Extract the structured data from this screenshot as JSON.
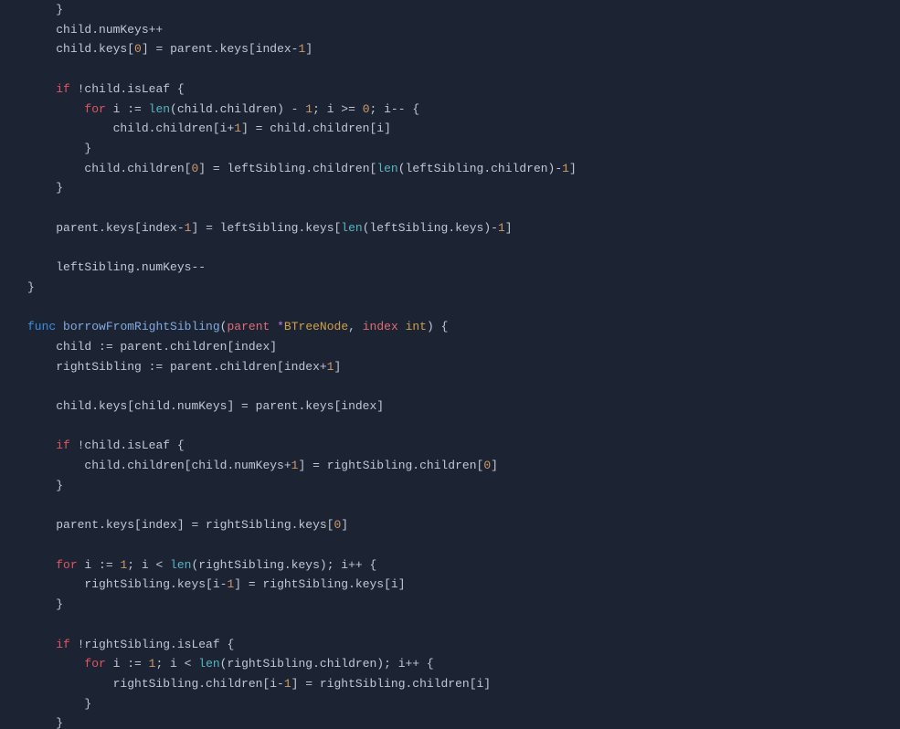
{
  "code": {
    "lines": [
      {
        "indent": 1,
        "tokens": [
          {
            "t": "}",
            "c": "punct"
          }
        ]
      },
      {
        "indent": 1,
        "tokens": [
          {
            "t": "child.numKeys++",
            "c": "punct"
          }
        ]
      },
      {
        "indent": 1,
        "tokens": [
          {
            "t": "child.keys[",
            "c": "punct"
          },
          {
            "t": "0",
            "c": "num"
          },
          {
            "t": "] = parent.keys[index-",
            "c": "punct"
          },
          {
            "t": "1",
            "c": "num"
          },
          {
            "t": "]",
            "c": "punct"
          }
        ]
      },
      {
        "indent": 0,
        "tokens": []
      },
      {
        "indent": 1,
        "tokens": [
          {
            "t": "if",
            "c": "kw-red"
          },
          {
            "t": " !child.isLeaf {",
            "c": "punct"
          }
        ]
      },
      {
        "indent": 2,
        "tokens": [
          {
            "t": "for",
            "c": "kw-red"
          },
          {
            "t": " i := ",
            "c": "punct"
          },
          {
            "t": "len",
            "c": "builtin"
          },
          {
            "t": "(child.children) - ",
            "c": "punct"
          },
          {
            "t": "1",
            "c": "num"
          },
          {
            "t": "; i >= ",
            "c": "punct"
          },
          {
            "t": "0",
            "c": "num"
          },
          {
            "t": "; i-- {",
            "c": "punct"
          }
        ]
      },
      {
        "indent": 3,
        "tokens": [
          {
            "t": "child.children[i+",
            "c": "punct"
          },
          {
            "t": "1",
            "c": "num"
          },
          {
            "t": "] = child.children[i]",
            "c": "punct"
          }
        ]
      },
      {
        "indent": 2,
        "tokens": [
          {
            "t": "}",
            "c": "punct"
          }
        ]
      },
      {
        "indent": 2,
        "tokens": [
          {
            "t": "child.children[",
            "c": "punct"
          },
          {
            "t": "0",
            "c": "num"
          },
          {
            "t": "] = leftSibling.children[",
            "c": "punct"
          },
          {
            "t": "len",
            "c": "builtin"
          },
          {
            "t": "(leftSibling.children)-",
            "c": "punct"
          },
          {
            "t": "1",
            "c": "num"
          },
          {
            "t": "]",
            "c": "punct"
          }
        ]
      },
      {
        "indent": 1,
        "tokens": [
          {
            "t": "}",
            "c": "punct"
          }
        ]
      },
      {
        "indent": 0,
        "tokens": []
      },
      {
        "indent": 1,
        "tokens": [
          {
            "t": "parent.keys[index-",
            "c": "punct"
          },
          {
            "t": "1",
            "c": "num"
          },
          {
            "t": "] = leftSibling.keys[",
            "c": "punct"
          },
          {
            "t": "len",
            "c": "builtin"
          },
          {
            "t": "(leftSibling.keys)-",
            "c": "punct"
          },
          {
            "t": "1",
            "c": "num"
          },
          {
            "t": "]",
            "c": "punct"
          }
        ]
      },
      {
        "indent": 0,
        "tokens": []
      },
      {
        "indent": 1,
        "tokens": [
          {
            "t": "leftSibling.numKeys--",
            "c": "punct"
          }
        ]
      },
      {
        "indent": 0,
        "tokens": [
          {
            "t": "}",
            "c": "punct"
          }
        ]
      },
      {
        "indent": 0,
        "tokens": []
      },
      {
        "indent": 0,
        "tokens": [
          {
            "t": "func",
            "c": "kw-blue"
          },
          {
            "t": " ",
            "c": "punct"
          },
          {
            "t": "borrowFromRightSibling",
            "c": "fn"
          },
          {
            "t": "(",
            "c": "punct"
          },
          {
            "t": "parent",
            "c": "param"
          },
          {
            "t": " ",
            "c": "punct"
          },
          {
            "t": "*",
            "c": "star"
          },
          {
            "t": "BTreeNode",
            "c": "type"
          },
          {
            "t": ", ",
            "c": "punct"
          },
          {
            "t": "index",
            "c": "param"
          },
          {
            "t": " ",
            "c": "punct"
          },
          {
            "t": "int",
            "c": "type"
          },
          {
            "t": ") {",
            "c": "punct"
          }
        ]
      },
      {
        "indent": 1,
        "tokens": [
          {
            "t": "child := parent.children[index]",
            "c": "punct"
          }
        ]
      },
      {
        "indent": 1,
        "tokens": [
          {
            "t": "rightSibling := parent.children[index+",
            "c": "punct"
          },
          {
            "t": "1",
            "c": "num"
          },
          {
            "t": "]",
            "c": "punct"
          }
        ]
      },
      {
        "indent": 0,
        "tokens": []
      },
      {
        "indent": 1,
        "tokens": [
          {
            "t": "child.keys[child.numKeys] = parent.keys[index]",
            "c": "punct"
          }
        ]
      },
      {
        "indent": 0,
        "tokens": []
      },
      {
        "indent": 1,
        "tokens": [
          {
            "t": "if",
            "c": "kw-red"
          },
          {
            "t": " !child.isLeaf {",
            "c": "punct"
          }
        ]
      },
      {
        "indent": 2,
        "tokens": [
          {
            "t": "child.children[child.numKeys+",
            "c": "punct"
          },
          {
            "t": "1",
            "c": "num"
          },
          {
            "t": "] = rightSibling.children[",
            "c": "punct"
          },
          {
            "t": "0",
            "c": "num"
          },
          {
            "t": "]",
            "c": "punct"
          }
        ]
      },
      {
        "indent": 1,
        "tokens": [
          {
            "t": "}",
            "c": "punct"
          }
        ]
      },
      {
        "indent": 0,
        "tokens": []
      },
      {
        "indent": 1,
        "tokens": [
          {
            "t": "parent.keys[index] = rightSibling.keys[",
            "c": "punct"
          },
          {
            "t": "0",
            "c": "num"
          },
          {
            "t": "]",
            "c": "punct"
          }
        ]
      },
      {
        "indent": 0,
        "tokens": []
      },
      {
        "indent": 1,
        "tokens": [
          {
            "t": "for",
            "c": "kw-red"
          },
          {
            "t": " i := ",
            "c": "punct"
          },
          {
            "t": "1",
            "c": "num"
          },
          {
            "t": "; i < ",
            "c": "punct"
          },
          {
            "t": "len",
            "c": "builtin"
          },
          {
            "t": "(rightSibling.keys); i++ {",
            "c": "punct"
          }
        ]
      },
      {
        "indent": 2,
        "tokens": [
          {
            "t": "rightSibling.keys[i-",
            "c": "punct"
          },
          {
            "t": "1",
            "c": "num"
          },
          {
            "t": "] = rightSibling.keys[i]",
            "c": "punct"
          }
        ]
      },
      {
        "indent": 1,
        "tokens": [
          {
            "t": "}",
            "c": "punct"
          }
        ]
      },
      {
        "indent": 0,
        "tokens": []
      },
      {
        "indent": 1,
        "tokens": [
          {
            "t": "if",
            "c": "kw-red"
          },
          {
            "t": " !rightSibling.isLeaf {",
            "c": "punct"
          }
        ]
      },
      {
        "indent": 2,
        "tokens": [
          {
            "t": "for",
            "c": "kw-red"
          },
          {
            "t": " i := ",
            "c": "punct"
          },
          {
            "t": "1",
            "c": "num"
          },
          {
            "t": "; i < ",
            "c": "punct"
          },
          {
            "t": "len",
            "c": "builtin"
          },
          {
            "t": "(rightSibling.children); i++ {",
            "c": "punct"
          }
        ]
      },
      {
        "indent": 3,
        "tokens": [
          {
            "t": "rightSibling.children[i-",
            "c": "punct"
          },
          {
            "t": "1",
            "c": "num"
          },
          {
            "t": "] = rightSibling.children[i]",
            "c": "punct"
          }
        ]
      },
      {
        "indent": 2,
        "tokens": [
          {
            "t": "}",
            "c": "punct"
          }
        ]
      },
      {
        "indent": 1,
        "tokens": [
          {
            "t": "}",
            "c": "punct"
          }
        ]
      }
    ],
    "indent_unit": "    "
  }
}
